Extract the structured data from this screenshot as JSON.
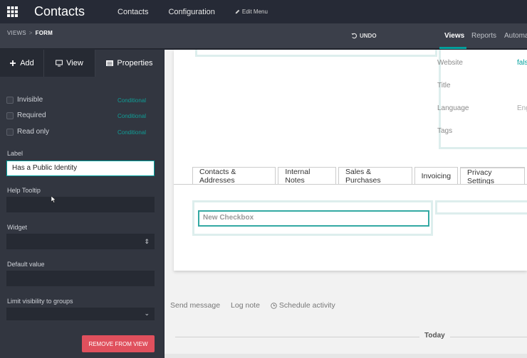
{
  "app": {
    "title": "Contacts",
    "nav": [
      "Contacts",
      "Configuration"
    ],
    "edit_menu": "Edit Menu"
  },
  "subbar": {
    "crumb_root": "VIEWS",
    "crumb_sep": ">",
    "crumb_current": "FORM",
    "undo": "UNDO",
    "tabs": [
      "Views",
      "Reports",
      "Automa"
    ]
  },
  "sidebar": {
    "tabs": {
      "add": "Add",
      "view": "View",
      "properties": "Properties"
    },
    "props": [
      {
        "label": "Invisible",
        "cond": "Conditional"
      },
      {
        "label": "Required",
        "cond": "Conditional"
      },
      {
        "label": "Read only",
        "cond": "Conditional"
      }
    ],
    "label_title": "Label",
    "label_value": "Has a Public Identity",
    "help_title": "Help Tooltip",
    "widget_title": "Widget",
    "default_title": "Default value",
    "groups_title": "Limit visibility to groups",
    "remove_button": "REMOVE FROM VIEW"
  },
  "form": {
    "right_fields": [
      {
        "label": "Website",
        "value": "fals"
      },
      {
        "label": "Title",
        "value": ""
      },
      {
        "label": "Language",
        "value": "Eng"
      },
      {
        "label": "Tags",
        "value": ""
      }
    ],
    "tabs": [
      "Contacts & Addresses",
      "Internal Notes",
      "Sales & Purchases",
      "Invoicing",
      "Privacy Settings"
    ],
    "new_checkbox": "New Checkbox"
  },
  "chatter": {
    "send": "Send message",
    "log": "Log note",
    "schedule": "Schedule activity",
    "today": "Today"
  },
  "colors": {
    "accent": "#00a09d",
    "danger": "#e0505d",
    "navbar": "#262a36"
  }
}
